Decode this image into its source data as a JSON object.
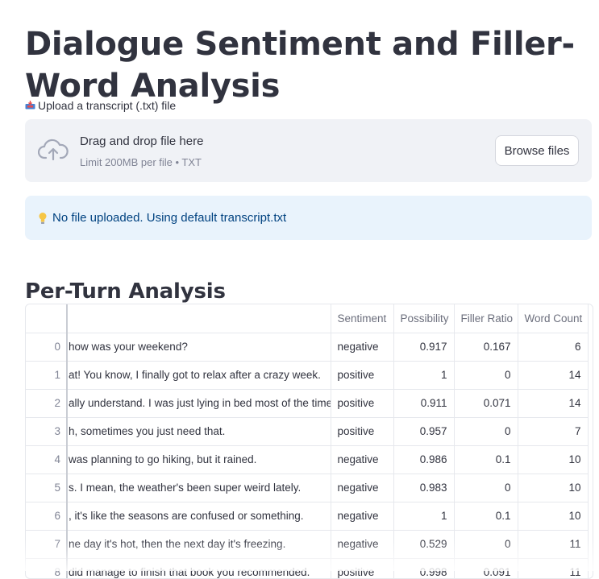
{
  "page": {
    "title": "Dialogue Sentiment and Filler-Word Analysis"
  },
  "uploader": {
    "label": "Upload a transcript (.txt) file",
    "label_icon": "inbox-tray-icon",
    "dropzone_title": "Drag and drop file here",
    "dropzone_limit": "Limit 200MB per file • TXT",
    "dropzone_icon": "cloud-upload-icon",
    "browse_label": "Browse files"
  },
  "info": {
    "icon": "lightbulb-icon",
    "message": "No file uploaded. Using default transcript.txt"
  },
  "section": {
    "title": "Per-Turn Analysis"
  },
  "table": {
    "columns": [
      "",
      "",
      "Sentiment",
      "Possibility",
      "Filler Ratio",
      "Word Count"
    ],
    "rows": [
      {
        "index": "0",
        "text": "how was your weekend?",
        "sentiment": "negative",
        "possibility": "0.917",
        "filler_ratio": "0.167",
        "word_count": "6"
      },
      {
        "index": "1",
        "text": "at! You know, I finally got to relax after a crazy week.",
        "sentiment": "positive",
        "possibility": "1",
        "filler_ratio": "0",
        "word_count": "14"
      },
      {
        "index": "2",
        "text": "ally understand. I was just lying in bed most of the time.",
        "sentiment": "positive",
        "possibility": "0.911",
        "filler_ratio": "0.071",
        "word_count": "14"
      },
      {
        "index": "3",
        "text": "h, sometimes you just need that.",
        "sentiment": "positive",
        "possibility": "0.957",
        "filler_ratio": "0",
        "word_count": "7"
      },
      {
        "index": "4",
        "text": " was planning to go hiking, but it rained.",
        "sentiment": "negative",
        "possibility": "0.986",
        "filler_ratio": "0.1",
        "word_count": "10"
      },
      {
        "index": "5",
        "text": "s. I mean, the weather's been super weird lately.",
        "sentiment": "negative",
        "possibility": "0.983",
        "filler_ratio": "0",
        "word_count": "10"
      },
      {
        "index": "6",
        "text": ", it's like the seasons are confused or something.",
        "sentiment": "negative",
        "possibility": "1",
        "filler_ratio": "0.1",
        "word_count": "10"
      },
      {
        "index": "7",
        "text": "ne day it's hot, then the next day it's freezing.",
        "sentiment": "negative",
        "possibility": "0.529",
        "filler_ratio": "0",
        "word_count": "11"
      },
      {
        "index": "8",
        "text": "did manage to finish that book you recommended.",
        "sentiment": "positive",
        "possibility": "0.998",
        "filler_ratio": "0.091",
        "word_count": "11"
      }
    ]
  },
  "colors": {
    "dropzone_bg": "#F0F2F6",
    "info_bg": "#E9F3FC",
    "info_text": "#004280",
    "text": "#31333F"
  }
}
